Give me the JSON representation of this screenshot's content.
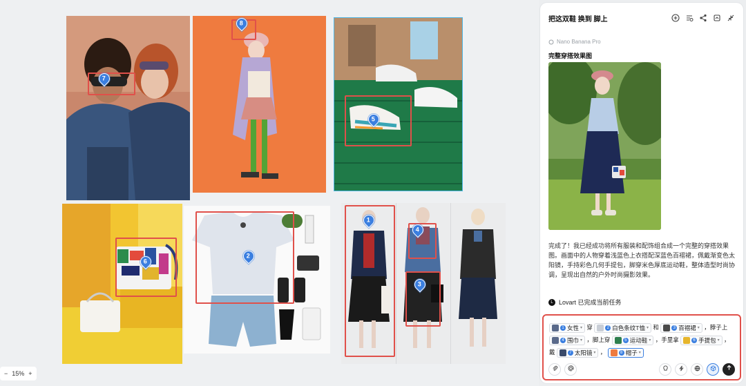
{
  "canvas": {
    "zoom_minus": "−",
    "zoom_level": "15%",
    "zoom_plus": "+",
    "pins": [
      "1",
      "2",
      "3",
      "4",
      "5",
      "6",
      "7",
      "8"
    ]
  },
  "panel": {
    "title": "把这双鞋 换到 脚上",
    "model": "Nano Banana Pro",
    "result_title": "完整穿搭效果图",
    "description": "完成了！我已经成功将所有服装和配饰组合成一个完整的穿搭效果图。画面中的人物穿着浅蓝色上衣搭配深蓝色百褶裙，佩戴渐变色太阳镜，手持彩色几何手提包，脚穿米色厚底运动鞋，整体造型时尚协调，呈现出自然的户外时尚摄影效果。",
    "status": "Lovart 已完成当前任务"
  },
  "prompt": {
    "parts": {
      "p1_chip": "女性",
      "t1": "穿",
      "p2_chip": "白色条纹T恤",
      "t2": "和",
      "p3_chip": "百褶裙",
      "t3": "，脖子上",
      "p4_chip": "围巾",
      "t4": "，脚上穿",
      "p5_chip": "运动鞋",
      "t5": "，手里拿",
      "p6_chip": "手提包",
      "t6": "，",
      "t7": "戴",
      "p7_chip": "太阳镜",
      "t8": "，",
      "p8_chip": "帽子"
    },
    "chip_numbers": [
      "1",
      "2",
      "3",
      "4",
      "5",
      "6",
      "7",
      "8"
    ]
  },
  "colors": {
    "selection": "#e0504a",
    "pin": "#3b7fe0"
  }
}
